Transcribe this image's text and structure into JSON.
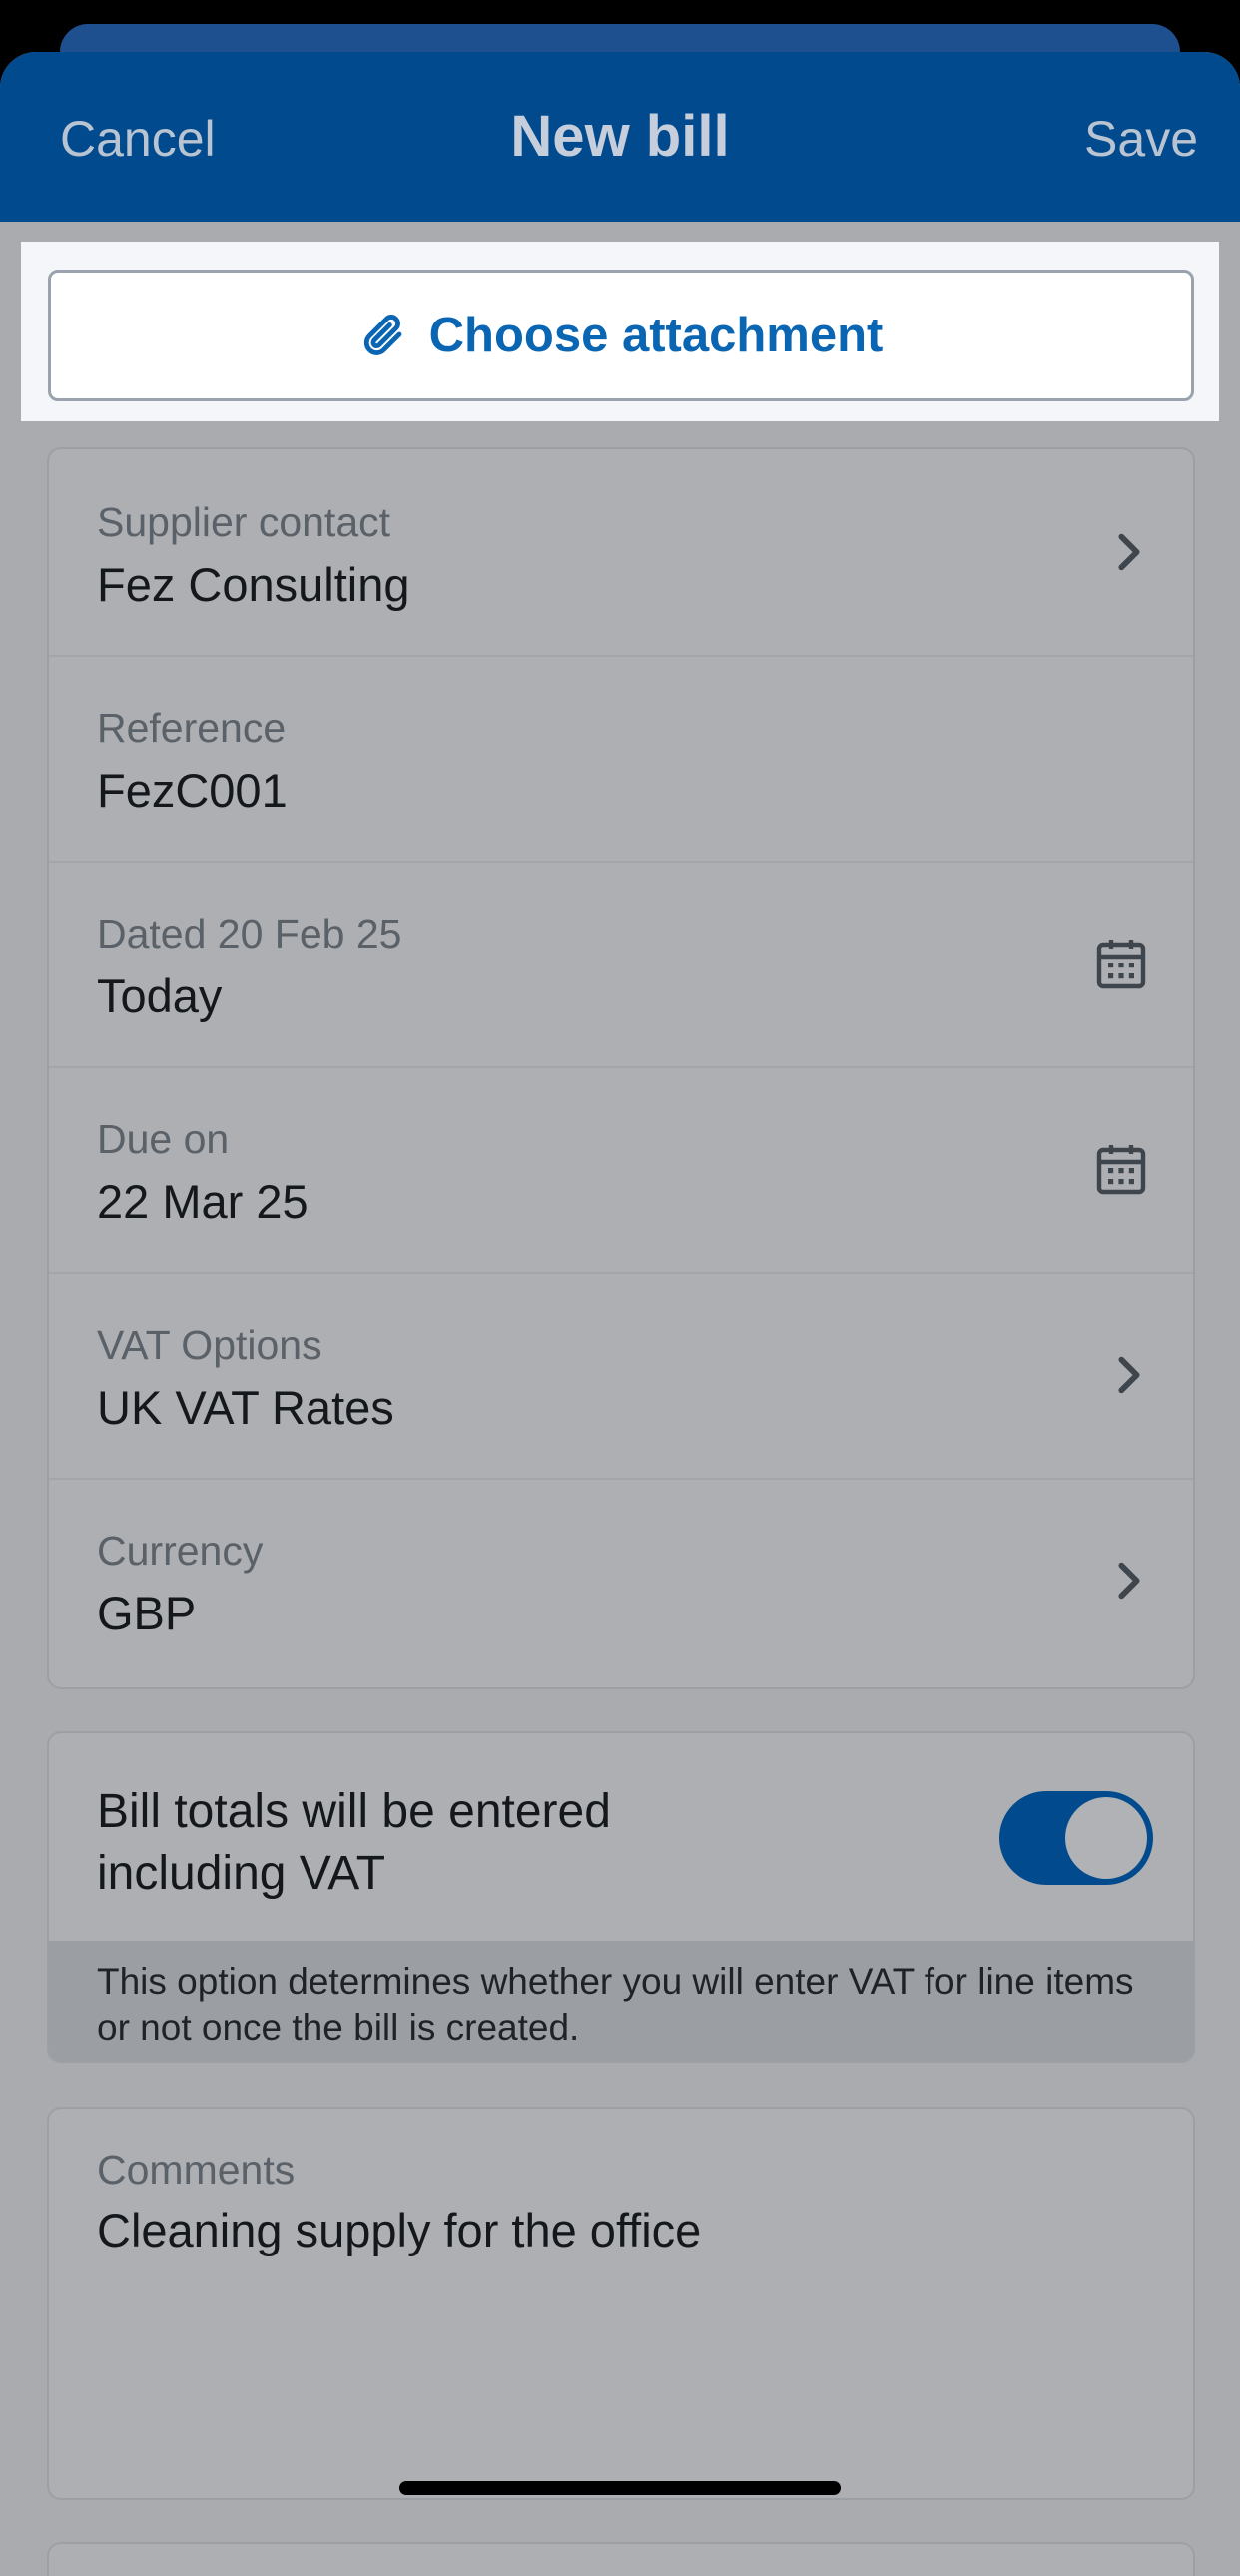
{
  "nav": {
    "cancel_label": "Cancel",
    "title": "New bill",
    "save_label": "Save"
  },
  "attachment": {
    "label": "Choose attachment",
    "icon": "paperclip-icon"
  },
  "fields": {
    "supplier": {
      "label": "Supplier contact",
      "value": "Fez Consulting",
      "icon": "chevron-right-icon"
    },
    "reference": {
      "label": "Reference",
      "value": "FezC001"
    },
    "dated": {
      "label": "Dated 20 Feb 25",
      "value": "Today",
      "icon": "calendar-icon"
    },
    "due": {
      "label": "Due on",
      "value": "22 Mar 25",
      "icon": "calendar-icon"
    },
    "vat_options": {
      "label": "VAT Options",
      "value": "UK VAT Rates",
      "icon": "chevron-right-icon"
    },
    "currency": {
      "label": "Currency",
      "value": "GBP",
      "icon": "chevron-right-icon"
    }
  },
  "vat_toggle": {
    "label": "Bill totals will be entered including VAT",
    "enabled": true,
    "note": "This option determines whether you will enter VAT for line items or not once the bill is created."
  },
  "comments": {
    "label": "Comments",
    "value": "Cleaning supply for the office"
  },
  "colors": {
    "brand": "#004a8d",
    "accent_link": "#0a66b2",
    "overlay_gray": "#a9abae"
  }
}
